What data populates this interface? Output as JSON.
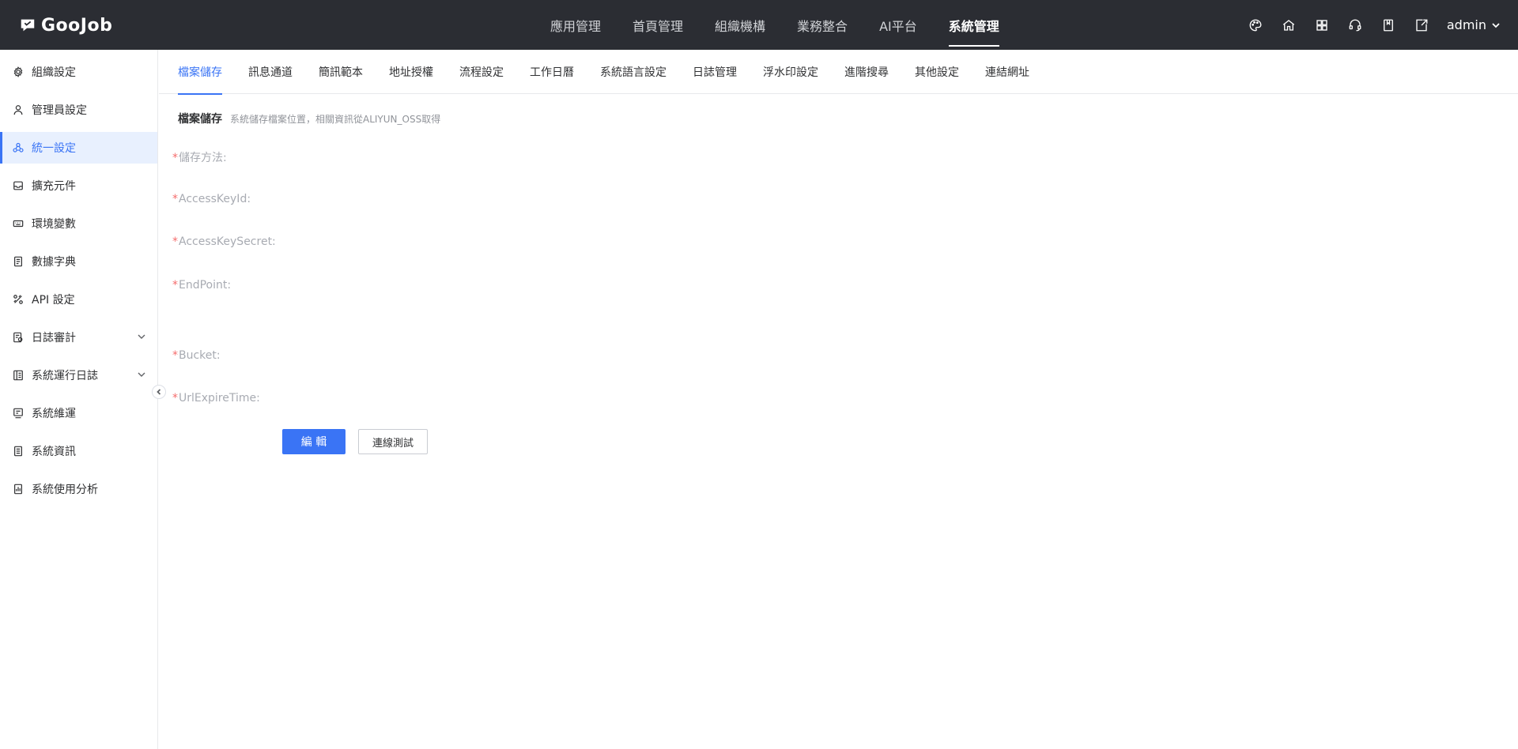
{
  "app": {
    "logo_text": "GooJob"
  },
  "topnav": [
    {
      "label": "應用管理"
    },
    {
      "label": "首頁管理"
    },
    {
      "label": "組織機構"
    },
    {
      "label": "業務整合"
    },
    {
      "label": "AI平台"
    },
    {
      "label": "系統管理",
      "active": true
    }
  ],
  "user": {
    "name": "admin"
  },
  "sidebar": {
    "items": [
      {
        "label": "組織設定",
        "icon": "gear-icon"
      },
      {
        "label": "管理員設定",
        "icon": "user-icon"
      },
      {
        "label": "統一設定",
        "icon": "cluster-icon",
        "active": true
      },
      {
        "label": "擴充元件",
        "icon": "inbox-icon"
      },
      {
        "label": "環境變數",
        "icon": "keyboard-icon"
      },
      {
        "label": "數據字典",
        "icon": "book-icon"
      },
      {
        "label": "API 設定",
        "icon": "api-icon"
      },
      {
        "label": "日誌審計",
        "icon": "audit-icon",
        "expandable": true
      },
      {
        "label": "系統運行日誌",
        "icon": "log-icon",
        "expandable": true
      },
      {
        "label": "系統維運",
        "icon": "maintenance-icon"
      },
      {
        "label": "系統資訊",
        "icon": "info-doc-icon"
      },
      {
        "label": "系統使用分析",
        "icon": "analysis-icon"
      }
    ]
  },
  "tabs": [
    {
      "label": "檔案儲存",
      "active": true
    },
    {
      "label": "訊息通道"
    },
    {
      "label": "簡訊範本"
    },
    {
      "label": "地址授權"
    },
    {
      "label": "流程設定"
    },
    {
      "label": "工作日曆"
    },
    {
      "label": "系統語言設定"
    },
    {
      "label": "日誌管理"
    },
    {
      "label": "浮水印設定"
    },
    {
      "label": "進階搜尋"
    },
    {
      "label": "其他設定"
    },
    {
      "label": "連結網址"
    }
  ],
  "section": {
    "title": "檔案儲存",
    "desc": "系統儲存檔案位置，相關資訊從ALIYUN_OSS取得"
  },
  "form": {
    "required_mark": "*",
    "fields": [
      {
        "label": "儲存方法:"
      },
      {
        "label": "AccessKeyId:"
      },
      {
        "label": "AccessKeySecret:"
      },
      {
        "label": "EndPoint:"
      },
      {
        "label": "Bucket:"
      },
      {
        "label": "UrlExpireTime:"
      }
    ]
  },
  "actions": {
    "edit_label": "編 輯",
    "test_label": "連線測試"
  },
  "colors": {
    "primary": "#3a74f5",
    "topbar": "#2b2d33",
    "required": "#f56c6c"
  }
}
